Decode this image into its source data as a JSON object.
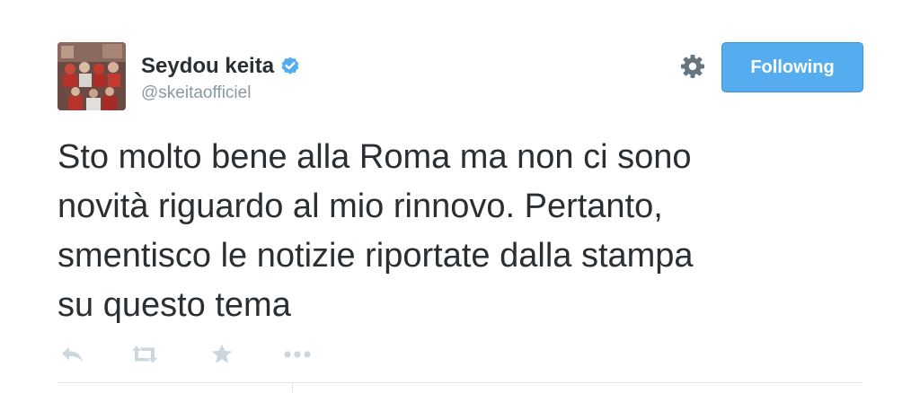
{
  "tweet": {
    "author": {
      "name": "Seydou keita",
      "handle": "@skeitaofficiel",
      "verified": true,
      "avatar_icon": "team-photo-avatar"
    },
    "follow_button_label": "Following",
    "settings_icon": "gear-icon",
    "text": "Sto molto bene alla Roma ma non ci sono\nnovità riguardo al mio rinnovo. Pertanto,\nsmentisco le notizie riportate dalla stampa\nsu questo tema",
    "actions": [
      {
        "name": "reply",
        "icon": "reply-icon"
      },
      {
        "name": "retweet",
        "icon": "retweet-icon"
      },
      {
        "name": "favorite",
        "icon": "star-icon"
      },
      {
        "name": "more",
        "icon": "more-dots-icon"
      }
    ]
  },
  "colors": {
    "accent": "#55acee",
    "text": "#292f33",
    "secondary_text": "#8899a6",
    "action_icons": "#ccd6dd",
    "verified_badge": "#55acee"
  }
}
